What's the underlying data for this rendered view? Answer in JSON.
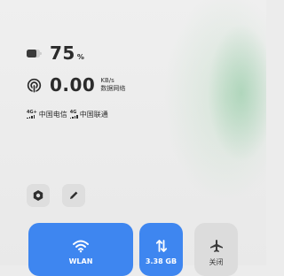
{
  "status": {
    "battery": {
      "value": "75",
      "unit": "%",
      "level": 0.75
    },
    "network_speed": {
      "value": "0.00",
      "unit": "KB/s",
      "label": "数据网络"
    },
    "carriers": [
      {
        "tag": "4G+",
        "name": "中国电信"
      },
      {
        "tag": "4G",
        "name": "中国联通"
      }
    ]
  },
  "quick_actions": [
    {
      "icon": "settings-hex-icon"
    },
    {
      "icon": "pencil-edit-icon"
    }
  ],
  "tiles": {
    "wlan": {
      "label": "WLAN",
      "icon": "wifi-icon",
      "active": true,
      "color": "#3e86f0"
    },
    "mobile_data": {
      "label": "3.38 GB",
      "icon": "data-transfer-icon",
      "active": true,
      "color": "#3e86f0"
    },
    "airplane": {
      "label": "关闭",
      "icon": "airplane-icon",
      "active": false,
      "color": "#dcdcdc"
    }
  },
  "colors": {
    "accent": "#3e86f0",
    "text": "#2b2b2b",
    "background": "#ececec"
  }
}
